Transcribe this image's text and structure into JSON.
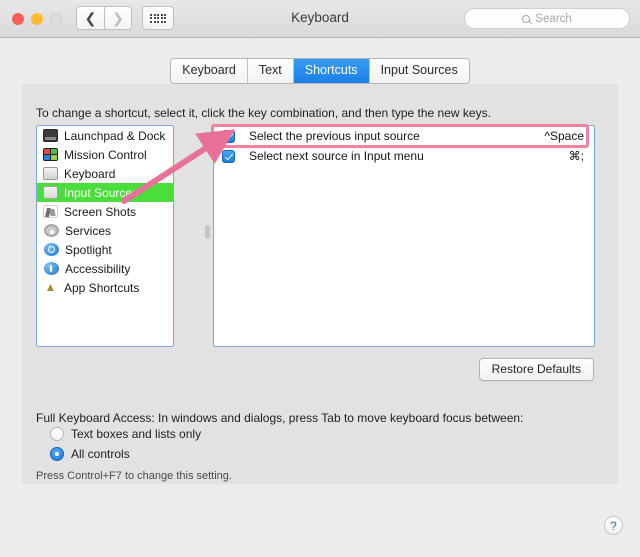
{
  "window": {
    "title": "Keyboard",
    "traffic_lights": [
      "close",
      "minimize",
      "zoom"
    ],
    "nav_back_icon": "chevron-left-icon",
    "nav_forward_icon": "chevron-right-icon",
    "grid_icon": "show-all-grid-icon"
  },
  "search": {
    "placeholder": "Search",
    "icon": "search-icon",
    "value": ""
  },
  "tabs": [
    {
      "label": "Keyboard",
      "selected": false
    },
    {
      "label": "Text",
      "selected": false
    },
    {
      "label": "Shortcuts",
      "selected": true
    },
    {
      "label": "Input Sources",
      "selected": false
    }
  ],
  "hint": "To change a shortcut, select it, click the key combination, and then type the new keys.",
  "categories": [
    {
      "label": "Launchpad & Dock",
      "icon": "launchpad-dock-icon",
      "selected": false
    },
    {
      "label": "Mission Control",
      "icon": "mission-control-icon",
      "selected": false
    },
    {
      "label": "Keyboard",
      "icon": "keyboard-icon",
      "selected": false
    },
    {
      "label": "Input Sources",
      "icon": "input-sources-icon",
      "selected": true
    },
    {
      "label": "Screen Shots",
      "icon": "screen-shots-icon",
      "selected": false
    },
    {
      "label": "Services",
      "icon": "services-gear-icon",
      "selected": false
    },
    {
      "label": "Spotlight",
      "icon": "spotlight-icon",
      "selected": false
    },
    {
      "label": "Accessibility",
      "icon": "accessibility-icon",
      "selected": false
    },
    {
      "label": "App Shortcuts",
      "icon": "app-shortcuts-icon",
      "selected": false
    }
  ],
  "shortcuts": [
    {
      "label": "Select the previous input source",
      "key": "^Space",
      "checked": true,
      "highlighted": true
    },
    {
      "label": "Select next source in Input menu",
      "key": "⌘;",
      "checked": true,
      "highlighted": false
    }
  ],
  "annotation": {
    "box_color": "#f4819f",
    "arrow_color": "#e8719a",
    "highlight_color": "#4ade3c"
  },
  "restore_defaults_label": "Restore Defaults",
  "full_keyboard_access": {
    "label": "Full Keyboard Access: In windows and dialogs, press Tab to move keyboard focus between:",
    "options": [
      {
        "label": "Text boxes and lists only",
        "selected": false
      },
      {
        "label": "All controls",
        "selected": true
      }
    ]
  },
  "footer_note": "Press Control+F7 to change this setting.",
  "help_label": "?"
}
